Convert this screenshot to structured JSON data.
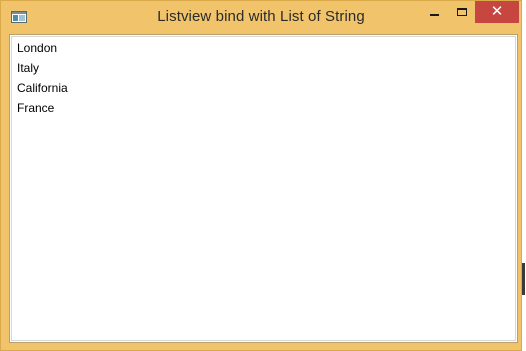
{
  "window": {
    "title": "Listview bind with List of String",
    "frame_color": "#f1c46b",
    "close_color": "#c7463f"
  },
  "controls": {
    "minimize_icon": "minimize-icon",
    "maximize_icon": "maximize-icon",
    "close_icon": "close-icon",
    "close_glyph": "✕"
  },
  "listview": {
    "items": [
      {
        "label": "London"
      },
      {
        "label": "Italy"
      },
      {
        "label": "California"
      },
      {
        "label": "France"
      }
    ]
  }
}
